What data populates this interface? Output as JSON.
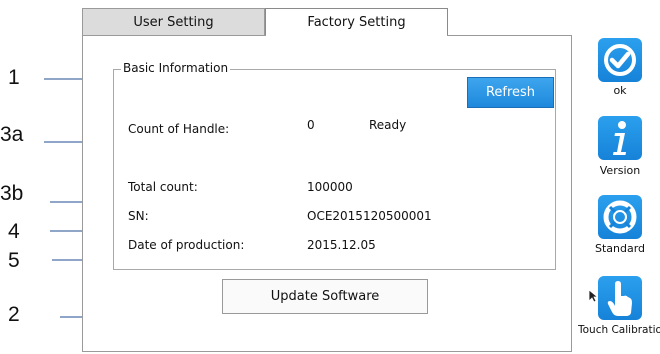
{
  "callouts": {
    "c1": "1",
    "c3a": "3a",
    "c3b": "3b",
    "c4": "4",
    "c5": "5",
    "c2": "2"
  },
  "tabs": [
    {
      "label": "User Setting",
      "active": false
    },
    {
      "label": "Factory Setting",
      "active": true
    }
  ],
  "basic_info": {
    "title": "Basic Information",
    "refresh_label": "Refresh",
    "count_of_handle": {
      "label": "Count of Handle:",
      "value": "0",
      "status": "Ready"
    },
    "total_count": {
      "label": "Total count:",
      "value": "100000"
    },
    "sn": {
      "label": "SN:",
      "value": "OCE2015120500001"
    },
    "date_of_production": {
      "label": "Date of production:",
      "value": "2015.12.05"
    }
  },
  "update_label": "Update Software",
  "side_buttons": [
    {
      "label": "ok",
      "icon": "checkmark-icon"
    },
    {
      "label": "Version",
      "icon": "info-icon"
    },
    {
      "label": "Standard",
      "icon": "lifebuoy-icon"
    },
    {
      "label": "Touch Calibration",
      "icon": "touch-hand-icon"
    }
  ],
  "colors": {
    "accent": "#1e88dc",
    "leader": "#8fa6c8"
  }
}
